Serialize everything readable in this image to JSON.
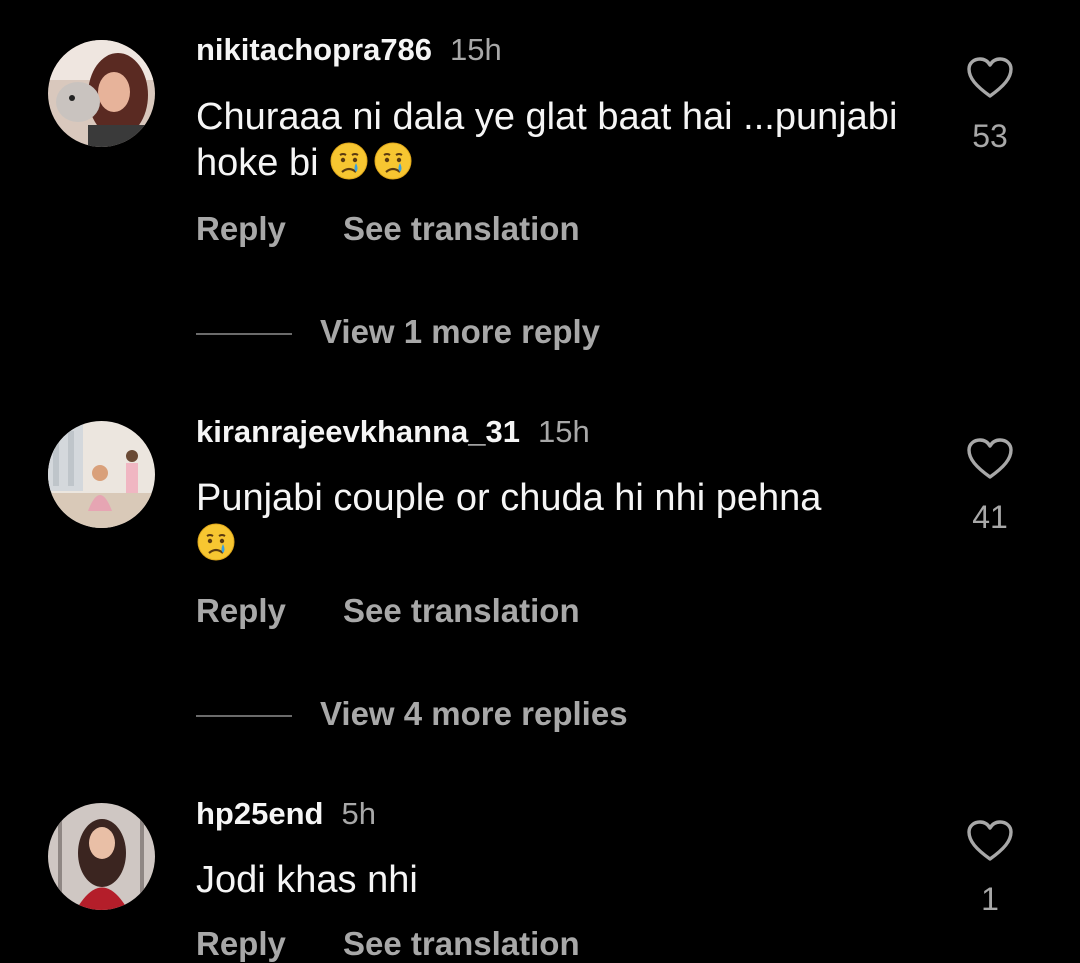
{
  "comments": [
    {
      "username": "nikitachopra786",
      "time": "15h",
      "text": "Churaaa ni dala ye glat baat hai ...punjabi hoke bi",
      "emoji": [
        "crying-face",
        "crying-face"
      ],
      "likes": "53",
      "reply_label": "Reply",
      "translate_label": "See translation",
      "view_replies": "View 1 more reply"
    },
    {
      "username": "kiranrajeevkhanna_31",
      "time": "15h",
      "text": "Punjabi couple or chuda hi nhi pehna",
      "emoji": [
        "crying-face"
      ],
      "likes": "41",
      "reply_label": "Reply",
      "translate_label": "See translation",
      "view_replies": "View 4 more replies"
    },
    {
      "username": "hp25end",
      "time": "5h",
      "text": "Jodi khas nhi",
      "emoji": [],
      "likes": "1",
      "reply_label": "Reply",
      "translate_label": "See translation"
    }
  ],
  "icons": {
    "like": "heart-outline-icon",
    "emoji": "crying-face-emoji"
  },
  "colors": {
    "background": "#000000",
    "primary_text": "#f5f5f5",
    "secondary_text": "#a8a8a8",
    "emoji_face": "#f7c631",
    "tear": "#3aa0e0"
  }
}
